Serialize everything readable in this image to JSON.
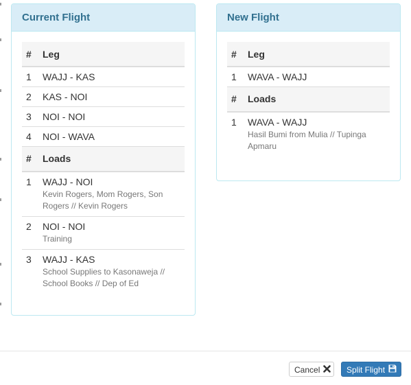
{
  "current_flight": {
    "title": "Current Flight",
    "legs_header": {
      "num": "#",
      "label": "Leg"
    },
    "legs": [
      {
        "num": "1",
        "route": "WAJJ - KAS"
      },
      {
        "num": "2",
        "route": "KAS - NOI"
      },
      {
        "num": "3",
        "route": "NOI - NOI"
      },
      {
        "num": "4",
        "route": "NOI - WAVA"
      }
    ],
    "loads_header": {
      "num": "#",
      "label": "Loads"
    },
    "loads": [
      {
        "num": "1",
        "route": "WAJJ - NOI",
        "description": "Kevin Rogers, Mom Rogers, Son Rogers // Kevin Rogers"
      },
      {
        "num": "2",
        "route": "NOI - NOI",
        "description": "Training"
      },
      {
        "num": "3",
        "route": "WAJJ - KAS",
        "description": "School Supplies to Kasonaweja // School Books // Dep of Ed"
      }
    ]
  },
  "new_flight": {
    "title": "New Flight",
    "legs_header": {
      "num": "#",
      "label": "Leg"
    },
    "legs": [
      {
        "num": "1",
        "route": "WAVA - WAJJ"
      }
    ],
    "loads_header": {
      "num": "#",
      "label": "Loads"
    },
    "loads": [
      {
        "num": "1",
        "route": "WAVA - WAJJ",
        "description": "Hasil Bumi from Mulia // Tupinga Apmaru"
      }
    ]
  },
  "footer": {
    "cancel_label": "Cancel",
    "cancel_icon": "close-icon",
    "split_label": "Split Flight",
    "split_icon": "floppy-disk-icon"
  },
  "colors": {
    "panel_heading_bg": "#d9edf7",
    "panel_heading_text": "#31708f",
    "panel_border": "#bce8f1",
    "primary": "#337ab7"
  }
}
